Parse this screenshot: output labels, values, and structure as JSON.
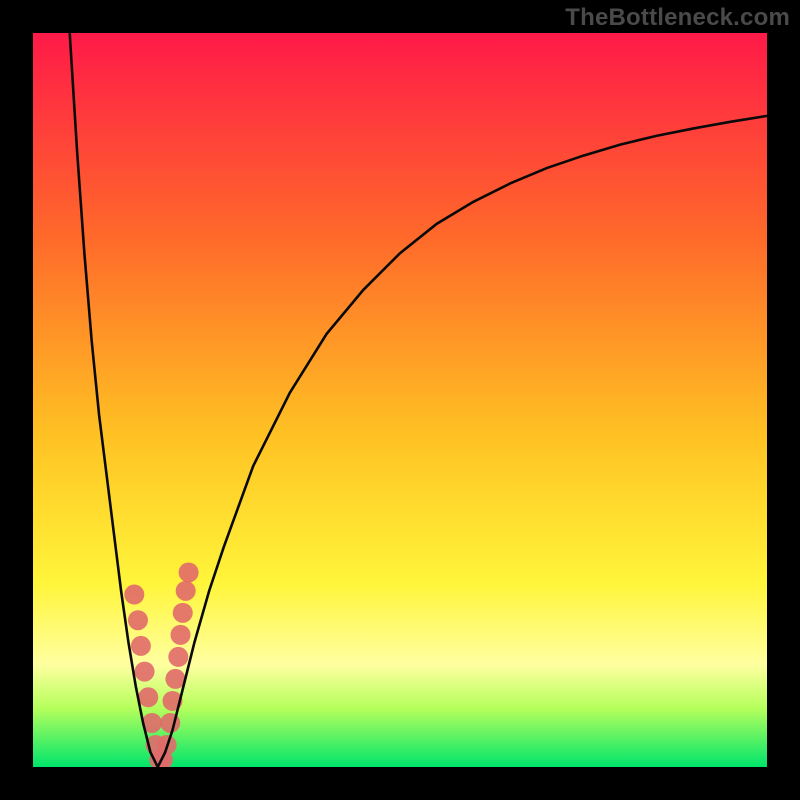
{
  "watermark": "TheBottleneck.com",
  "colors": {
    "frame_bg": "#000000",
    "grad_top": "#ff1a48",
    "grad_mid1": "#ff6a2a",
    "grad_mid2": "#ffc223",
    "grad_mid3": "#fff53a",
    "grad_band": "#ffffa0",
    "grad_green_top": "#b5ff5c",
    "grad_green": "#00e56b",
    "curve_stroke": "#0a0a0a",
    "dot_fill": "#e16a6a"
  },
  "plot": {
    "x_range": [
      0,
      100
    ],
    "y_range": [
      0,
      100
    ],
    "trough_x": 17
  },
  "chart_data": {
    "type": "line",
    "title": "",
    "xlabel": "",
    "ylabel": "",
    "xlim": [
      0,
      100
    ],
    "ylim": [
      0,
      100
    ],
    "series": [
      {
        "name": "left-branch",
        "x": [
          5,
          6,
          7,
          8,
          9,
          10,
          11,
          12,
          13,
          14,
          15,
          16,
          17
        ],
        "values": [
          100,
          84,
          70,
          58,
          48,
          40,
          32,
          24,
          17,
          11,
          6,
          2,
          0
        ]
      },
      {
        "name": "right-branch",
        "x": [
          17,
          18,
          19,
          20,
          21,
          22,
          24,
          26,
          30,
          35,
          40,
          45,
          50,
          55,
          60,
          65,
          70,
          75,
          80,
          85,
          90,
          95,
          100
        ],
        "values": [
          0,
          2,
          5,
          9,
          13,
          17,
          24,
          30,
          41,
          51,
          59,
          65,
          70,
          74,
          77,
          79.5,
          81.6,
          83.3,
          84.8,
          86,
          87,
          87.9,
          88.7
        ]
      }
    ],
    "highlight_points": {
      "name": "dots",
      "x": [
        13.8,
        14.3,
        14.7,
        15.2,
        15.7,
        16.2,
        16.7,
        17.2,
        17.7,
        18.2,
        18.7,
        19.0,
        19.4,
        19.8,
        20.1,
        20.4,
        20.8,
        21.2
      ],
      "values": [
        23.5,
        20.0,
        16.5,
        13.0,
        9.5,
        6.0,
        3.0,
        1.0,
        1.0,
        3.0,
        6.0,
        9.0,
        12.0,
        15.0,
        18.0,
        21.0,
        24.0,
        26.5
      ]
    }
  }
}
